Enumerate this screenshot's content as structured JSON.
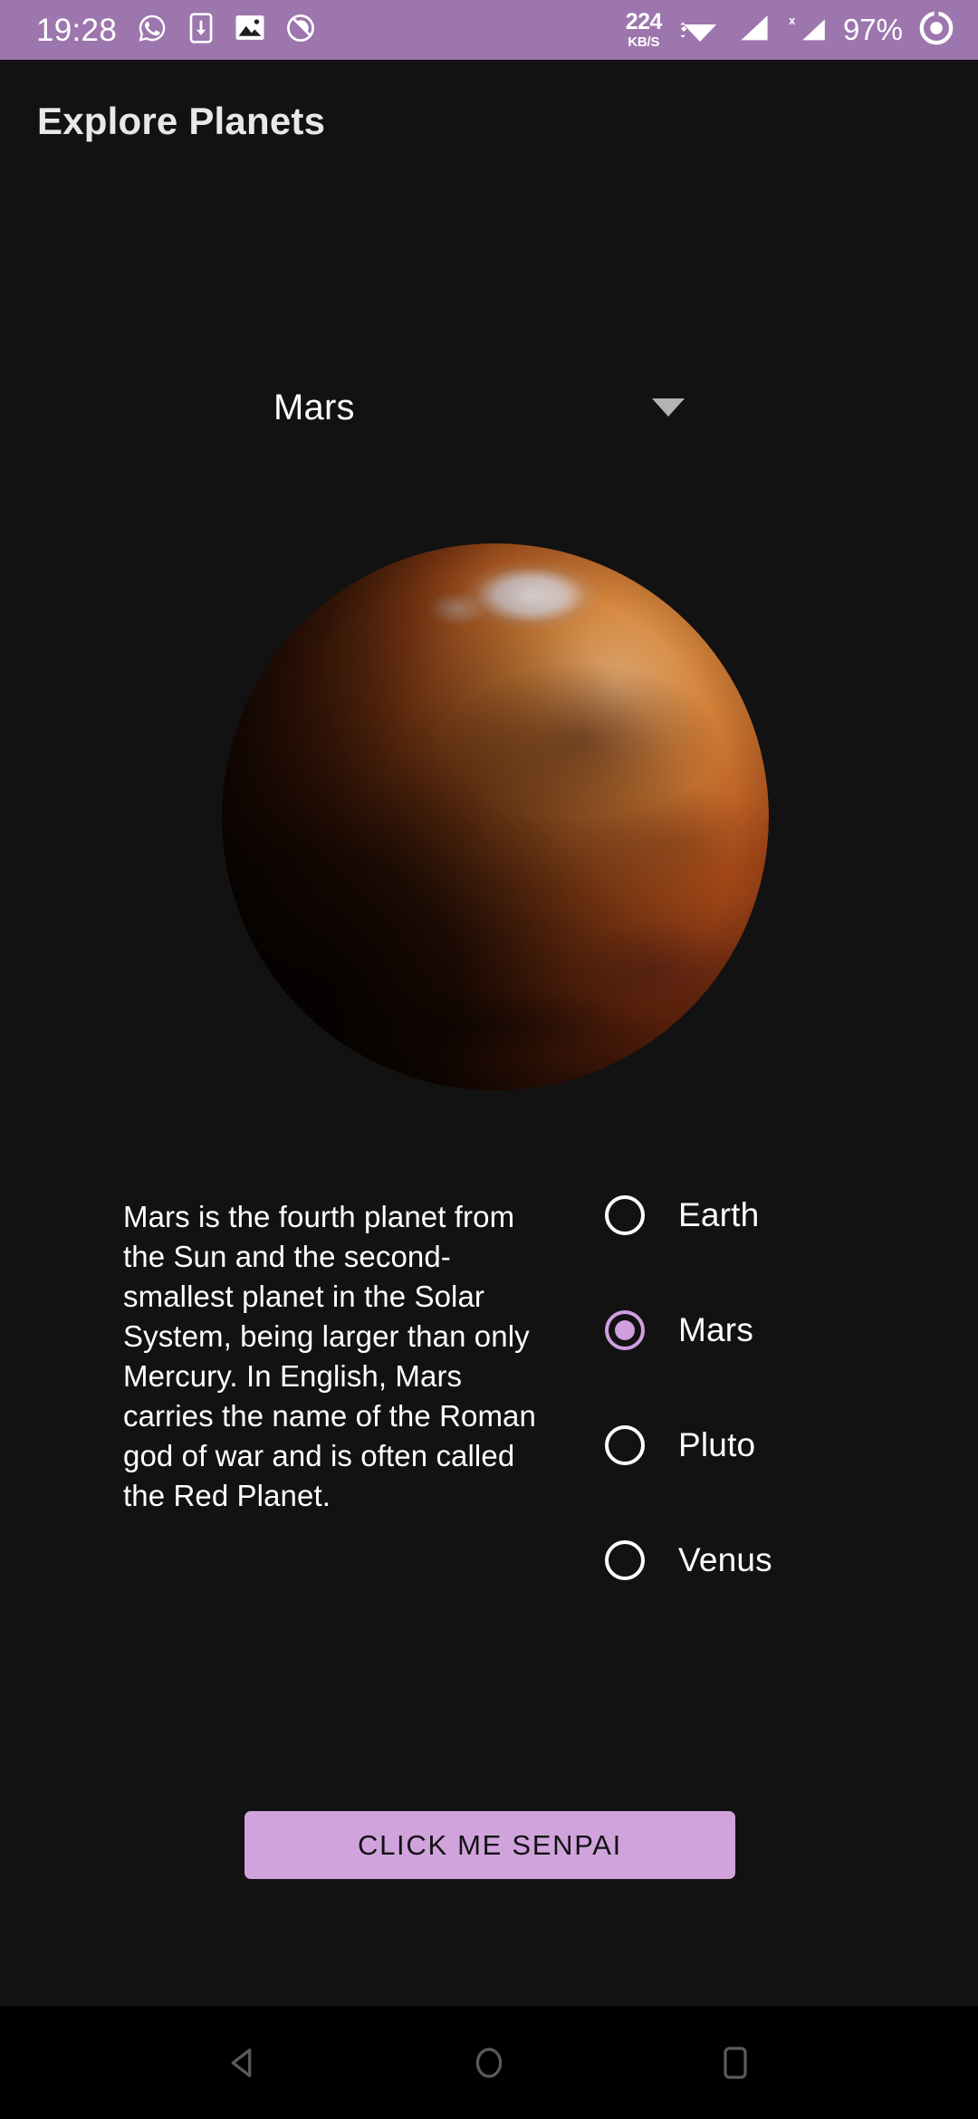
{
  "status_bar": {
    "clock": "19:28",
    "icons": [
      "whatsapp-icon",
      "phone-download-icon",
      "gallery-icon",
      "dnd-icon"
    ],
    "net_speed_value": "224",
    "net_speed_unit": "KB/S",
    "wifi": "wifi-icon",
    "signal_1": "signal-bars-icon",
    "signal_2": "signal-bars-no-sim-icon",
    "signal_2_badge": "x",
    "battery_percent": "97%",
    "battery_icon": "battery-circle-icon",
    "background_color": "#9d76ad",
    "foreground_color": "#ffffff"
  },
  "app_bar": {
    "title": "Explore Planets"
  },
  "spinner": {
    "name": "planet-spinner",
    "selected": "Mars",
    "options": [
      "Earth",
      "Mars",
      "Pluto",
      "Venus"
    ],
    "caret_color": "#b3b3b3"
  },
  "planet_image": {
    "name": "mars-planet-image",
    "alt": "Mars",
    "dominant_color": "#c1561d",
    "highlight_color": "#f0b478"
  },
  "description": {
    "text": "Mars is the fourth planet from the Sun and the second-smallest planet in the Solar System, being larger than only Mercury. In English, Mars carries the name of the Roman god of war and is often called the Red Planet."
  },
  "radio_group": {
    "selected": "Mars",
    "accent_color": "#cf9fe0",
    "items": [
      {
        "label": "Earth",
        "selected": false
      },
      {
        "label": "Mars",
        "selected": true
      },
      {
        "label": "Pluto",
        "selected": false
      },
      {
        "label": "Venus",
        "selected": false
      }
    ]
  },
  "action_button": {
    "label": "CLICK ME SENPAI",
    "background_color": "#d1a3dd",
    "text_color": "#121212"
  },
  "nav_bar": {
    "back": "back-triangle-icon",
    "home": "home-circle-icon",
    "recents": "recents-square-icon",
    "icon_color": "#5a5a5a",
    "background_color": "#000000"
  },
  "theme": {
    "background_color": "#121212",
    "text_color": "#ffffff"
  }
}
